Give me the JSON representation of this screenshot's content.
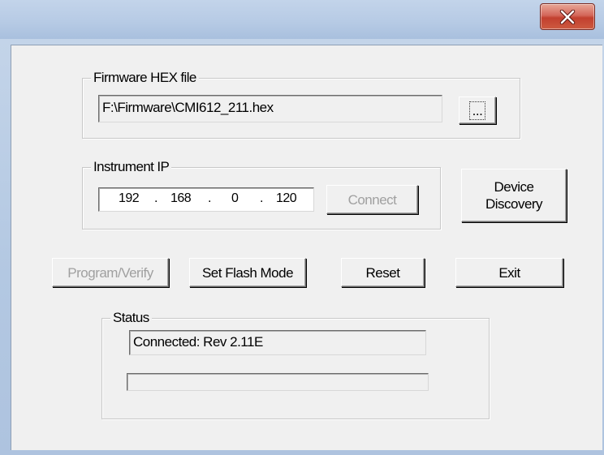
{
  "window": {
    "title": ""
  },
  "firmware": {
    "group_label": "Firmware HEX file",
    "path": "F:\\Firmware\\CMI612_211.hex",
    "browse_label": "..."
  },
  "instrument": {
    "group_label": "Instrument IP",
    "ip": [
      "192",
      "168",
      "0",
      "120"
    ],
    "connect_label": "Connect"
  },
  "device_discovery": {
    "line1": "Device",
    "line2": "Discovery"
  },
  "actions": {
    "program_verify_label": "Program/Verify",
    "set_flash_mode_label": "Set Flash Mode",
    "reset_label": "Reset",
    "exit_label": "Exit"
  },
  "status": {
    "group_label": "Status",
    "text": "Connected: Rev 2.11E",
    "progress": 0
  },
  "colors": {
    "close_button": "#c7402f",
    "disabled_text": "#a0a0a0",
    "title_bar": "#b7cbe5"
  }
}
